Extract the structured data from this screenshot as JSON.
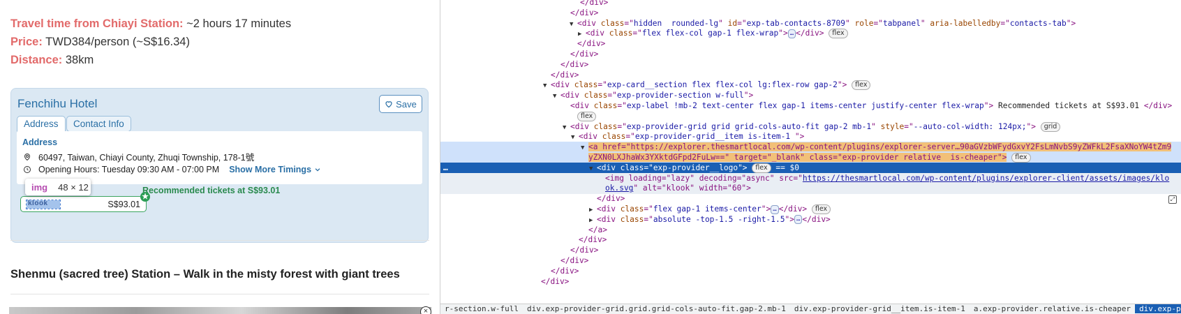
{
  "page": {
    "travel_time_label": "Travel time from Chiayi Station:",
    "travel_time_value": " ~2 hours 17 minutes",
    "price_label": "Price:",
    "price_value": " TWD384/person (~S$16.34)",
    "distance_label": "Distance:",
    "distance_value": " 38km",
    "hotel": {
      "name": "Fenchihu Hotel",
      "save_label": "Save",
      "tabs": [
        "Address",
        "Contact Info"
      ],
      "address_heading": "Address",
      "address": "60497, Taiwan, Chiayi County, Zhuqi Township, 178-1號",
      "hours": "Opening Hours: Tuesday 09:30 AM - 07:00 PM",
      "show_more": "Show More Timings"
    },
    "recommended_label": "Recommended tickets at S$93.01",
    "provider": {
      "logo_alt": "klook",
      "price": "S$93.01"
    },
    "tooltip": {
      "tag": "img",
      "dims": "48 × 12"
    },
    "section_title": "Shenmu (sacred tree) Station – Walk in the misty forest with giant trees",
    "colors": {
      "label_red": "#e26a6a",
      "link_blue": "#2a6fa5",
      "success_green": "#3aa45f"
    }
  },
  "devtools": {
    "lines": [
      {
        "t": "</div>"
      },
      {
        "t": "</div>"
      },
      {
        "pre": "<div ",
        "attrs": [
          [
            "class",
            "hidden  rounded-lg"
          ],
          [
            "id",
            "exp-tab-contacts-8709"
          ],
          [
            "role",
            "tabpanel"
          ],
          [
            "aria-labelledby",
            "contacts-tab"
          ]
        ],
        "post": ">"
      },
      {
        "pre": "<div ",
        "attrs": [
          [
            "class",
            "flex flex-col gap-1 flex-wrap"
          ]
        ],
        "post": ">",
        "ell": "…",
        "close": "</div>",
        "chip": "flex"
      },
      {
        "t": "</div>"
      },
      {
        "t": "</div>"
      },
      {
        "t": "</div>"
      },
      {
        "t": "</div>"
      },
      {
        "pre": "<div ",
        "attrs": [
          [
            "class",
            "exp-card__section flex flex-col lg:flex-row gap-2"
          ]
        ],
        "post": ">",
        "chip": "flex"
      },
      {
        "pre": "<div ",
        "attrs": [
          [
            "class",
            "exp-provider-section w-full"
          ]
        ],
        "post": ">"
      },
      {
        "pre": "<div ",
        "attrs": [
          [
            "class",
            "exp-label !mb-2 text-center flex gap-1 items-center justify-center flex-wrap"
          ]
        ],
        "post": ">",
        "text": " Recommended tickets at S$93.01 ",
        "close": "</div>"
      },
      {
        "chip_only": "flex"
      },
      {
        "pre": "<div ",
        "attrs": [
          [
            "class",
            "exp-provider-grid grid grid-cols-auto-fit gap-2 mb-1"
          ],
          [
            "style",
            "--auto-col-width: 124px;"
          ]
        ],
        "post": ">",
        "chip": "grid"
      },
      {
        "pre": "<div ",
        "attrs": [
          [
            "class",
            "exp-provider-grid__item is-item-1 "
          ]
        ],
        "post": ">"
      },
      {
        "anchor1": "<a href=\"https://explorer.thesmartlocal.com/wp-content/plugins/explorer-server…90aGVzbWFydGxvY2FsLmNvbS9yZWFkL2FsaXNoYW4tZm9"
      },
      {
        "anchor2": "yZXN0LXJhaWx3YXktdGFpd2FuLw==\" target=\"_blank\" class=\"exp-provider relative  is-cheaper\">",
        "chip": "flex"
      },
      {
        "sel": "<div class=\"exp-provider__logo\">",
        "chip": "flex",
        "eq": " == $0"
      },
      {
        "img1": "<img loading=\"lazy\" decoding=\"async\" src=\"",
        "url": "https://thesmartlocal.com/wp-content/plugins/explorer-client/assets/images/klo"
      },
      {
        "img2": "ok.svg",
        "rest": "\" alt=\"klook\" width=\"60\">"
      },
      {
        "t": "</div>"
      },
      {
        "pre": "<div ",
        "attrs": [
          [
            "class",
            "flex gap-1 items-center"
          ]
        ],
        "post": ">",
        "ell": "…",
        "close": "</div>",
        "chip": "flex"
      },
      {
        "pre": "<div ",
        "attrs": [
          [
            "class",
            "absolute -top-1.5 -right-1.5"
          ]
        ],
        "post": ">",
        "ell": "…",
        "close": "</div>"
      },
      {
        "t": "</a>"
      },
      {
        "t": "</div>"
      },
      {
        "t": "</div>"
      },
      {
        "t": "</div>"
      },
      {
        "t": "</div>"
      },
      {
        "t": "</div>"
      }
    ],
    "breadcrumb": [
      "r-section.w-full",
      "div.exp-provider-grid.grid.grid-cols-auto-fit.gap-2.mb-1",
      "div.exp-provider-grid__item.is-item-1",
      "a.exp-provider.relative.is-cheaper",
      "div.exp-provider__logo"
    ]
  }
}
